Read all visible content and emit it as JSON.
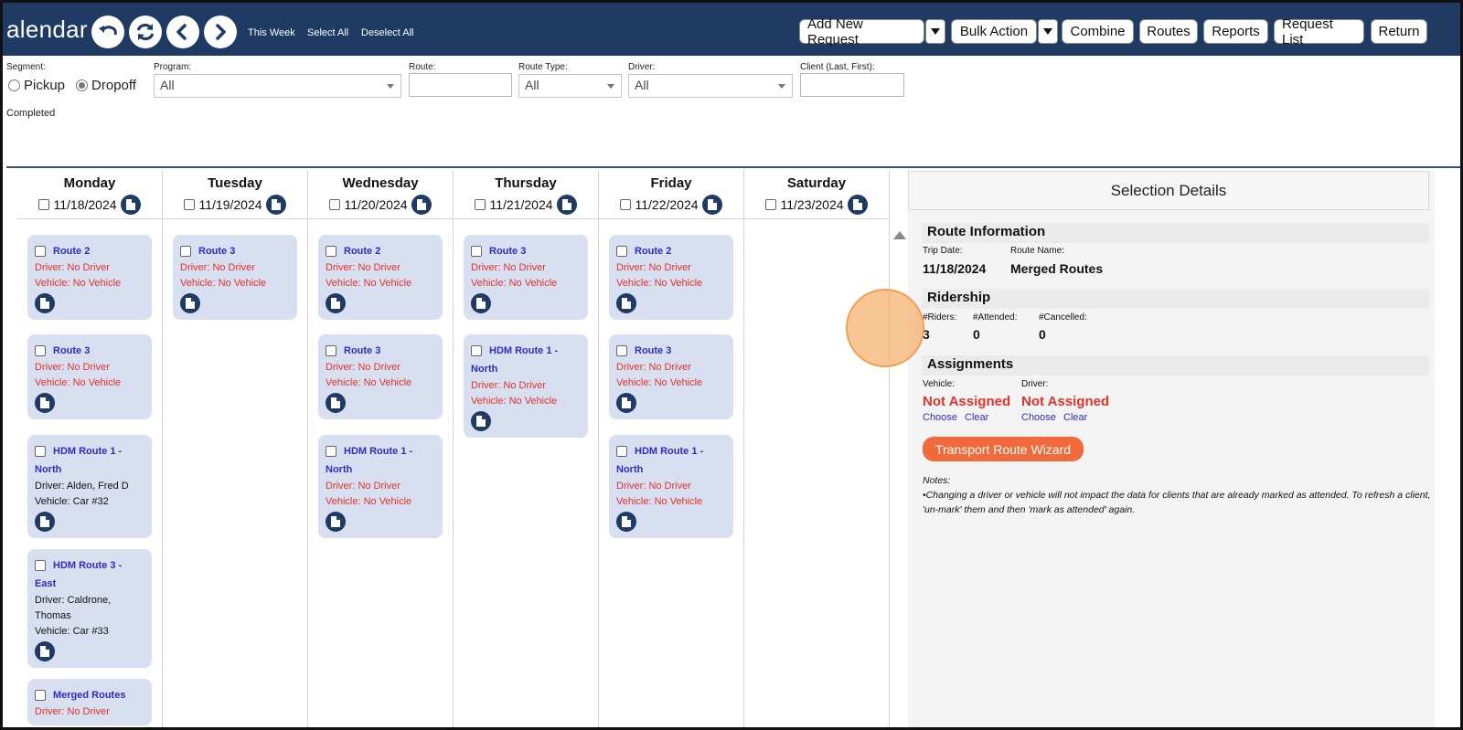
{
  "header": {
    "title": "alendar",
    "links": [
      "This Week",
      "Select All",
      "Deselect All"
    ],
    "buttons": {
      "add_new_request": "Add New Request",
      "bulk_action": "Bulk Action",
      "combine": "Combine",
      "routes": "Routes",
      "reports": "Reports",
      "request_list": "Request List",
      "return": "Return"
    },
    "icons": [
      "undo-icon",
      "refresh-icon",
      "prev-icon",
      "next-icon"
    ]
  },
  "filters": {
    "segment_label": "Segment:",
    "pickup_label": "Pickup",
    "dropoff_label": "Dropoff",
    "selected_segment": "Dropoff",
    "program_label": "Program:",
    "program_value": "All",
    "route_label": "Route:",
    "route_value": "",
    "route_type_label": "Route Type:",
    "route_type_value": "All",
    "driver_label": "Driver:",
    "driver_value": "All",
    "client_label": "Client (Last, First):",
    "client_value": "",
    "completed_label": "Completed"
  },
  "calendar": {
    "days": [
      {
        "name": "Monday",
        "date": "11/18/2024",
        "cards": [
          {
            "title": [
              "Route 2"
            ],
            "driver": [
              "Driver: No Driver"
            ],
            "vehicle": "Vehicle: No Vehicle",
            "assigned": false
          },
          {
            "title": [
              "Route 3"
            ],
            "driver": [
              "Driver: No Driver"
            ],
            "vehicle": "Vehicle: No Vehicle",
            "assigned": false
          },
          {
            "title": [
              "HDM Route 1 -",
              "North"
            ],
            "driver": [
              "Driver: Alden, Fred D"
            ],
            "vehicle": "Vehicle: Car #32",
            "assigned": true
          },
          {
            "title": [
              "HDM Route 3 -",
              "East"
            ],
            "driver": [
              "Driver: Caldrone,",
              "Thomas"
            ],
            "vehicle": "Vehicle: Car #33",
            "assigned": true
          },
          {
            "title": [
              "Merged Routes"
            ],
            "driver": [
              "Driver: No Driver"
            ],
            "vehicle": "",
            "assigned": false
          }
        ]
      },
      {
        "name": "Tuesday",
        "date": "11/19/2024",
        "cards": [
          {
            "title": [
              "Route 3"
            ],
            "driver": [
              "Driver: No Driver"
            ],
            "vehicle": "Vehicle: No Vehicle",
            "assigned": false
          }
        ]
      },
      {
        "name": "Wednesday",
        "date": "11/20/2024",
        "cards": [
          {
            "title": [
              "Route 2"
            ],
            "driver": [
              "Driver: No Driver"
            ],
            "vehicle": "Vehicle: No Vehicle",
            "assigned": false
          },
          {
            "title": [
              "Route 3"
            ],
            "driver": [
              "Driver: No Driver"
            ],
            "vehicle": "Vehicle: No Vehicle",
            "assigned": false
          },
          {
            "title": [
              "HDM Route 1 -",
              "North"
            ],
            "driver": [
              "Driver: No Driver"
            ],
            "vehicle": "Vehicle: No Vehicle",
            "assigned": false
          }
        ]
      },
      {
        "name": "Thursday",
        "date": "11/21/2024",
        "cards": [
          {
            "title": [
              "Route 3"
            ],
            "driver": [
              "Driver: No Driver"
            ],
            "vehicle": "Vehicle: No Vehicle",
            "assigned": false
          },
          {
            "title": [
              "HDM Route 1 -",
              "North"
            ],
            "driver": [
              "Driver: No Driver"
            ],
            "vehicle": "Vehicle: No Vehicle",
            "assigned": false
          }
        ]
      },
      {
        "name": "Friday",
        "date": "11/22/2024",
        "cards": [
          {
            "title": [
              "Route 2"
            ],
            "driver": [
              "Driver: No Driver"
            ],
            "vehicle": "Vehicle: No Vehicle",
            "assigned": false
          },
          {
            "title": [
              "Route 3"
            ],
            "driver": [
              "Driver: No Driver"
            ],
            "vehicle": "Vehicle: No Vehicle",
            "assigned": false
          },
          {
            "title": [
              "HDM Route 1 -",
              "North"
            ],
            "driver": [
              "Driver: No Driver"
            ],
            "vehicle": "Vehicle: No Vehicle",
            "assigned": false
          }
        ]
      },
      {
        "name": "Saturday",
        "date": "11/23/2024",
        "cards": []
      }
    ]
  },
  "details": {
    "heading": "Selection Details",
    "route_info": {
      "title": "Route Information",
      "trip_date_label": "Trip Date:",
      "trip_date": "11/18/2024",
      "route_name_label": "Route Name:",
      "route_name": "Merged Routes"
    },
    "ridership": {
      "title": "Ridership",
      "riders_label": "#Riders:",
      "riders": "3",
      "attended_label": "#Attended:",
      "attended": "0",
      "cancelled_label": "#Cancelled:",
      "cancelled": "0"
    },
    "assignments": {
      "title": "Assignments",
      "vehicle_label": "Vehicle:",
      "vehicle_value": "Not Assigned",
      "driver_label": "Driver:",
      "driver_value": "Not Assigned",
      "choose": "Choose",
      "clear": "Clear"
    },
    "wizard_button": "Transport Route Wizard",
    "notes_label": "Notes:",
    "notes_text": "•Changing a driver or vehicle will not impact the data for clients that are already marked as attended. To refresh a client, 'un-mark' them and then 'mark as attended' again."
  },
  "colors": {
    "header_bg": "#1f3a63",
    "card_bg": "#d7dff0",
    "link": "#2d2dbf",
    "alert": "#e0332b",
    "wizard": "#f16a3c"
  }
}
